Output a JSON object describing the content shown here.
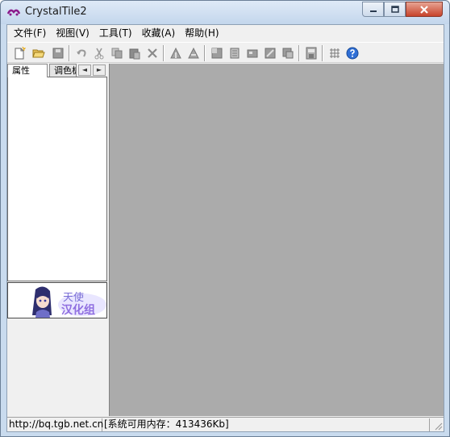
{
  "window": {
    "title": "CrystalTile2"
  },
  "menubar": {
    "items": [
      {
        "label": "文件(F)"
      },
      {
        "label": "视图(V)"
      },
      {
        "label": "工具(T)"
      },
      {
        "label": "收藏(A)"
      },
      {
        "label": "帮助(H)"
      }
    ]
  },
  "toolbar": {
    "buttons": [
      "new-file-icon",
      "open-folder-icon",
      "save-icon",
      "undo-icon",
      "cut-icon",
      "copy-icon",
      "paste-icon",
      "delete-icon",
      "tile-import-icon",
      "tile-export-icon",
      "palette-1-icon",
      "palette-2-icon",
      "palette-3-icon",
      "palette-4-icon",
      "palette-5-icon",
      "floppy-icon",
      "grid-icon",
      "help-icon"
    ]
  },
  "left_panel": {
    "tabs": [
      {
        "label": "属性"
      },
      {
        "label": "调色板"
      }
    ],
    "tab_scroll_left": "◄",
    "tab_scroll_right": "►",
    "logo": {
      "text_top": "天使",
      "text_bottom": "汉化组"
    }
  },
  "statusbar": {
    "url": "http://bq.tgb.net.cn",
    "memory": "[系统可用内存：413436Kb]"
  },
  "colors": {
    "workspace": "#ababab",
    "titlebar": "#c9dbee",
    "close_button": "#c7432b"
  }
}
